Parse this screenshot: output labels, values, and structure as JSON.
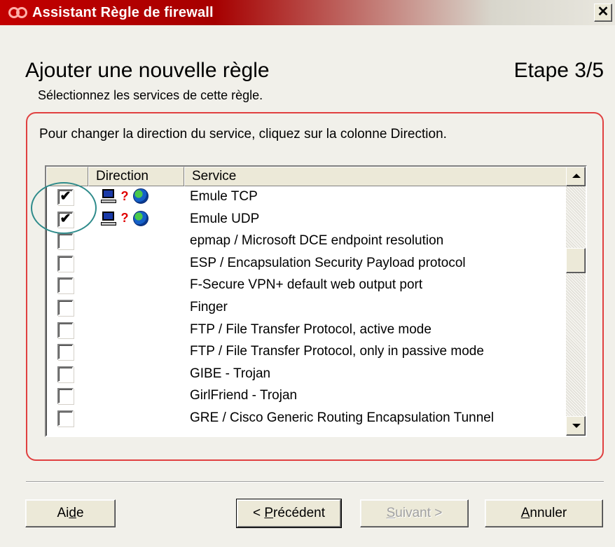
{
  "window": {
    "title": "Assistant Règle de firewall",
    "close_symbol": "✕",
    "logo_icon": "f-secure-logo-icon"
  },
  "header": {
    "heading": "Ajouter une nouvelle règle",
    "step": "Etape 3/5",
    "subheading": "Sélectionnez les services de cette règle."
  },
  "panel": {
    "instruction": "Pour changer la direction du service, cliquez sur la colonne Direction.",
    "accent_color": "#e04040",
    "columns": [
      "",
      "Direction",
      "Service"
    ],
    "rows": [
      {
        "checked": true,
        "check_mark": "✔",
        "direction": "computer-unknown-internet",
        "direction_symbol": "?",
        "service": "Emule TCP"
      },
      {
        "checked": true,
        "check_mark": "✔",
        "direction": "computer-unknown-internet",
        "direction_symbol": "?",
        "service": "Emule UDP"
      },
      {
        "checked": false,
        "check_mark": "",
        "direction": "",
        "direction_symbol": "",
        "service": "epmap / Microsoft DCE endpoint resolution"
      },
      {
        "checked": false,
        "check_mark": "",
        "direction": "",
        "direction_symbol": "",
        "service": "ESP / Encapsulation Security Payload protocol"
      },
      {
        "checked": false,
        "check_mark": "",
        "direction": "",
        "direction_symbol": "",
        "service": "F-Secure VPN+ default web output port"
      },
      {
        "checked": false,
        "check_mark": "",
        "direction": "",
        "direction_symbol": "",
        "service": "Finger"
      },
      {
        "checked": false,
        "check_mark": "",
        "direction": "",
        "direction_symbol": "",
        "service": "FTP / File Transfer Protocol, active mode"
      },
      {
        "checked": false,
        "check_mark": "",
        "direction": "",
        "direction_symbol": "",
        "service": "FTP / File Transfer Protocol, only in passive mode"
      },
      {
        "checked": false,
        "check_mark": "",
        "direction": "",
        "direction_symbol": "",
        "service": "GIBE - Trojan"
      },
      {
        "checked": false,
        "check_mark": "",
        "direction": "",
        "direction_symbol": "",
        "service": "GirlFriend - Trojan"
      },
      {
        "checked": false,
        "check_mark": "",
        "direction": "",
        "direction_symbol": "",
        "service": "GRE / Cisco Generic Routing Encapsulation Tunnel"
      }
    ],
    "scroll_position": 0.3
  },
  "buttons": {
    "help": "Aide",
    "previous": "< Précédent",
    "next": "Suivant >",
    "next_enabled": false,
    "cancel": "Annuler"
  }
}
